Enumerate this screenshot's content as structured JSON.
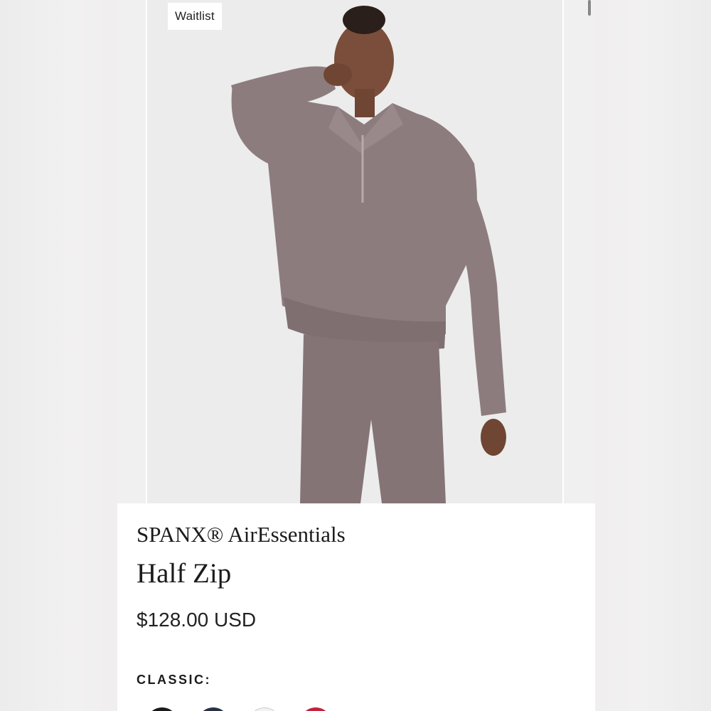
{
  "product": {
    "badge": "Waitlist",
    "brand": "SPANX® AirEssentials",
    "name": "Half Zip",
    "price": "$128.00 USD",
    "color_group_label": "CLASSIC:",
    "swatches": [
      {
        "name": "black",
        "color": "#1a1a1a"
      },
      {
        "name": "navy",
        "color": "#2b3145"
      },
      {
        "name": "white",
        "color": "#f2f2f2"
      },
      {
        "name": "red",
        "color": "#c3213c"
      }
    ]
  },
  "colors": {
    "garment": "#8d7c7e",
    "skin": "#7a4e3a",
    "background": "#ececec"
  }
}
